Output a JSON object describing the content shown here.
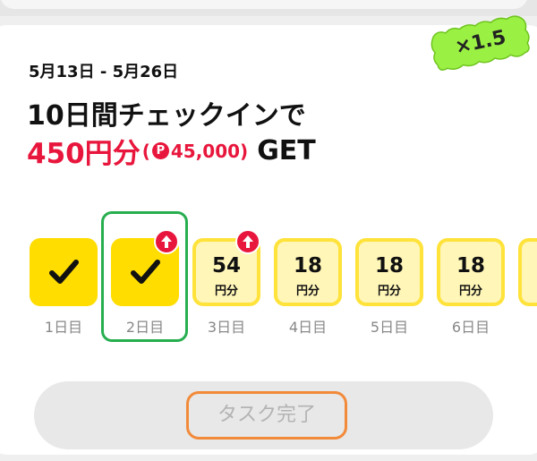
{
  "campaign": {
    "multiplier": "×1.5",
    "period": "5月13日 - 5月26日",
    "headline": "10日間チェックインで",
    "reward_amount": "450円分",
    "reward_open": "(",
    "points_icon": "P",
    "reward_points": "45,000)",
    "reward_get": "GET"
  },
  "days": [
    {
      "label": "1日目",
      "status": "done"
    },
    {
      "label": "2日目",
      "status": "done",
      "boosted": true
    },
    {
      "label": "3日目",
      "amount": "54",
      "unit": "円分",
      "boosted": true
    },
    {
      "label": "4日目",
      "amount": "18",
      "unit": "円分"
    },
    {
      "label": "5日目",
      "amount": "18",
      "unit": "円分"
    },
    {
      "label": "6日目",
      "amount": "18",
      "unit": "円分"
    }
  ],
  "action": {
    "label": "タスク完了"
  },
  "colors": {
    "accent_red": "#e8163c",
    "check_yellow": "#ffdd00",
    "pending_bg": "#fff6b8",
    "badge_green": "#9bf044",
    "highlight_green": "#27ae4f",
    "highlight_orange": "#f28a3a"
  },
  "icons": {
    "check": "check-icon",
    "boost": "up-arrow-icon",
    "points": "points-icon"
  }
}
